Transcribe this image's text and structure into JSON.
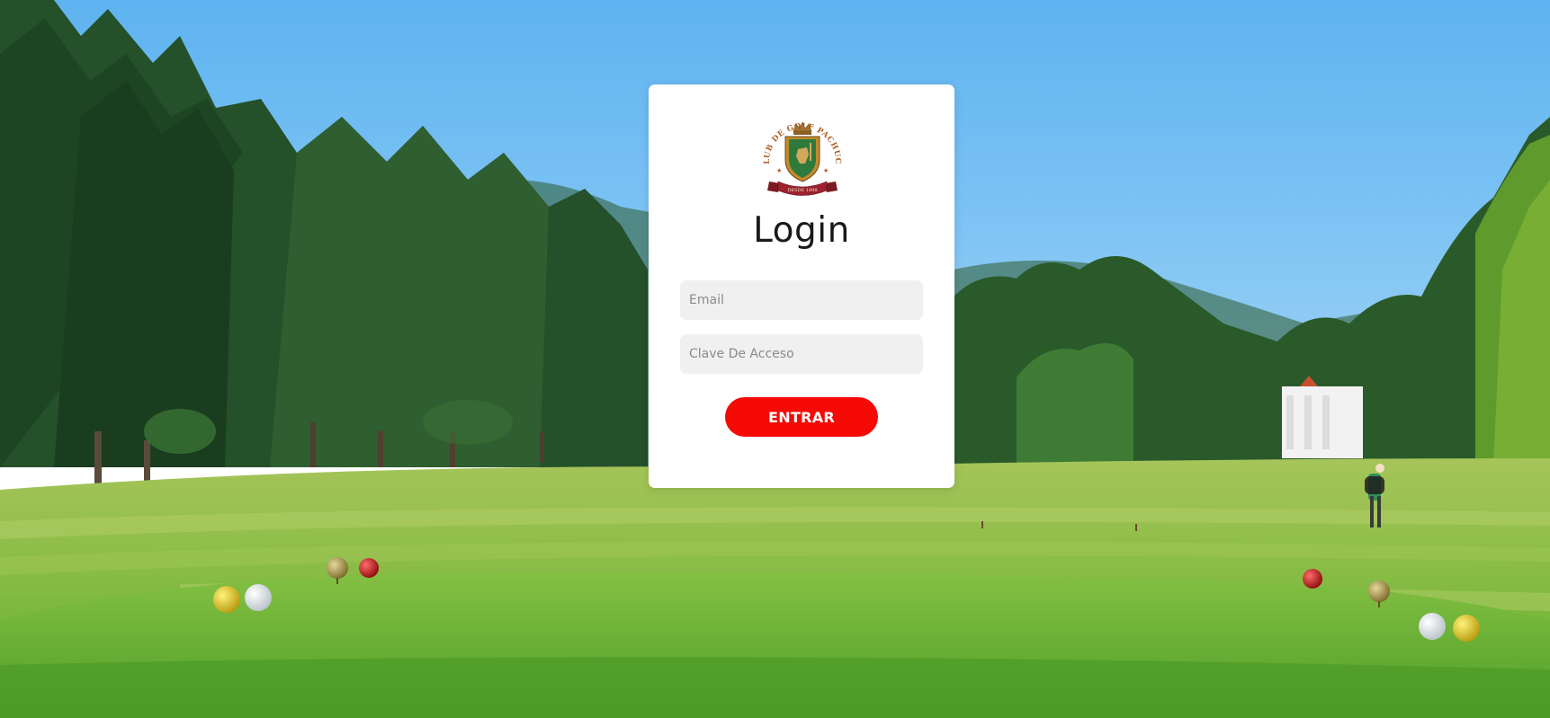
{
  "login": {
    "title": "Login",
    "email_placeholder": "Email",
    "password_placeholder": "Clave De Acceso",
    "submit_label": "ENTRAR"
  },
  "logo": {
    "arc_text": "CLUB DE GOLF PACHUCA",
    "ribbon_text": "DESDE 1898"
  },
  "colors": {
    "button": "#f50a06",
    "card": "#ffffff",
    "field_bg": "#f0f0f0"
  }
}
